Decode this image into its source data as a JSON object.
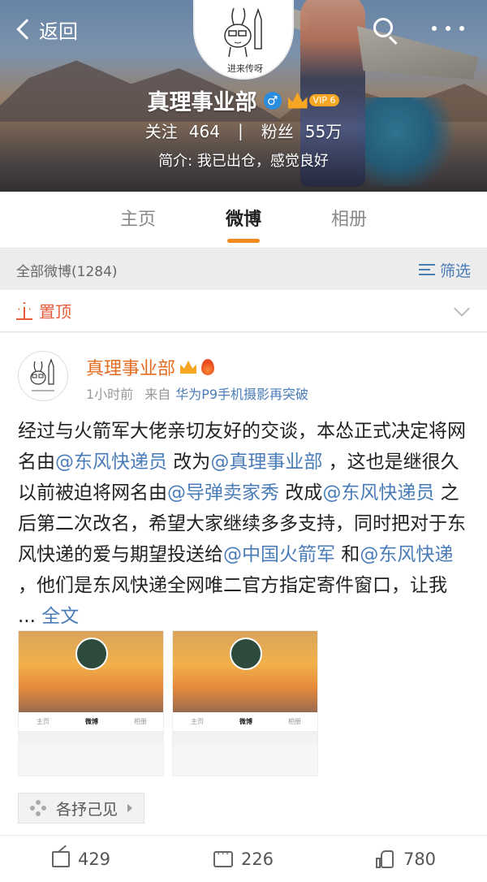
{
  "header": {
    "back_label": "返回",
    "name": "真理事业部",
    "vip_level": "VIP 6",
    "follow_label": "关注",
    "follow_count": "464",
    "fans_label": "粉丝",
    "fans_count": "55万",
    "bio": "简介: 我已出仓，感觉良好",
    "avatar_caption": "进来传呀"
  },
  "tabs": [
    {
      "label": "主页",
      "active": false
    },
    {
      "label": "微博",
      "active": true
    },
    {
      "label": "相册",
      "active": false
    }
  ],
  "filter": {
    "all_label": "全部微博(1284)",
    "filter_label": "筛选"
  },
  "pinned": {
    "label": "置顶"
  },
  "post": {
    "author": "真理事业部",
    "time": "1小时前",
    "source_prefix": "来自",
    "source": "华为P9手机摄影再突破",
    "text_parts": [
      {
        "t": "经过与火箭军大佬亲切友好的交谈，本怂正式决定将网名由",
        "m": false
      },
      {
        "t": "@东风快递员",
        "m": true
      },
      {
        "t": " 改为",
        "m": false
      },
      {
        "t": "@真理事业部",
        "m": true
      },
      {
        "t": " ，这也是继很久以前被迫将网名由",
        "m": false
      },
      {
        "t": "@导弹卖家秀",
        "m": true
      },
      {
        "t": " 改成",
        "m": false
      },
      {
        "t": "@东风快递员",
        "m": true
      },
      {
        "t": " 之后第二次改名，希望大家继续多多支持，同时把对于东风快递的爱与期望投送给",
        "m": false
      },
      {
        "t": "@中国火箭军",
        "m": true
      },
      {
        "t": " 和",
        "m": false
      },
      {
        "t": "@东风快递",
        "m": true
      },
      {
        "t": " ，他们是东风快递全网唯二官方指定寄件窗口，让我 ... ",
        "m": false
      }
    ],
    "full_text_label": "全文",
    "visibility_label": "各抒己见"
  },
  "actions": {
    "reposts": "429",
    "comments": "226",
    "likes": "780"
  },
  "colors": {
    "accent_orange": "#f28a1d",
    "link_blue": "#4a7cb8",
    "pinned_red": "#e85b3a"
  }
}
